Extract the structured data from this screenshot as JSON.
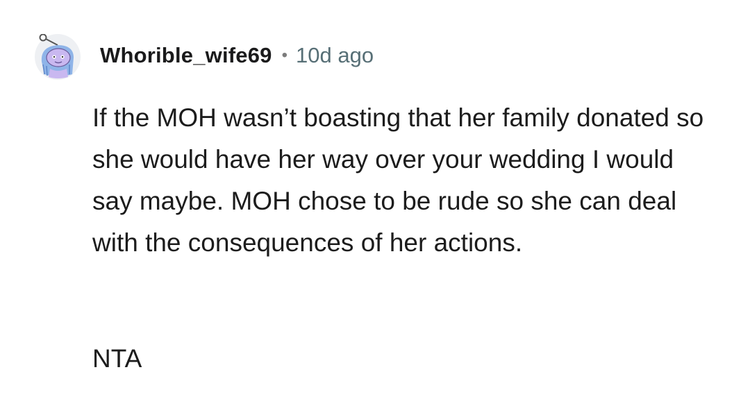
{
  "comment": {
    "author": {
      "username": "Whorible_wife69",
      "avatar_icon": "snoo-avatar-icon"
    },
    "separator": "•",
    "timestamp": "10d ago",
    "body": "If the MOH wasn’t boasting that her family donated so she would have her way over your wedding I would say maybe. MOH chose to be rude so she can deal with the consequences of her actions.",
    "verdict": "NTA"
  },
  "colors": {
    "username": "#1a1a1b",
    "timestamp": "#576f76",
    "body_text": "#1c1c1c",
    "avatar_body": "#c9b8f0",
    "avatar_accent": "#8fb4e8"
  }
}
